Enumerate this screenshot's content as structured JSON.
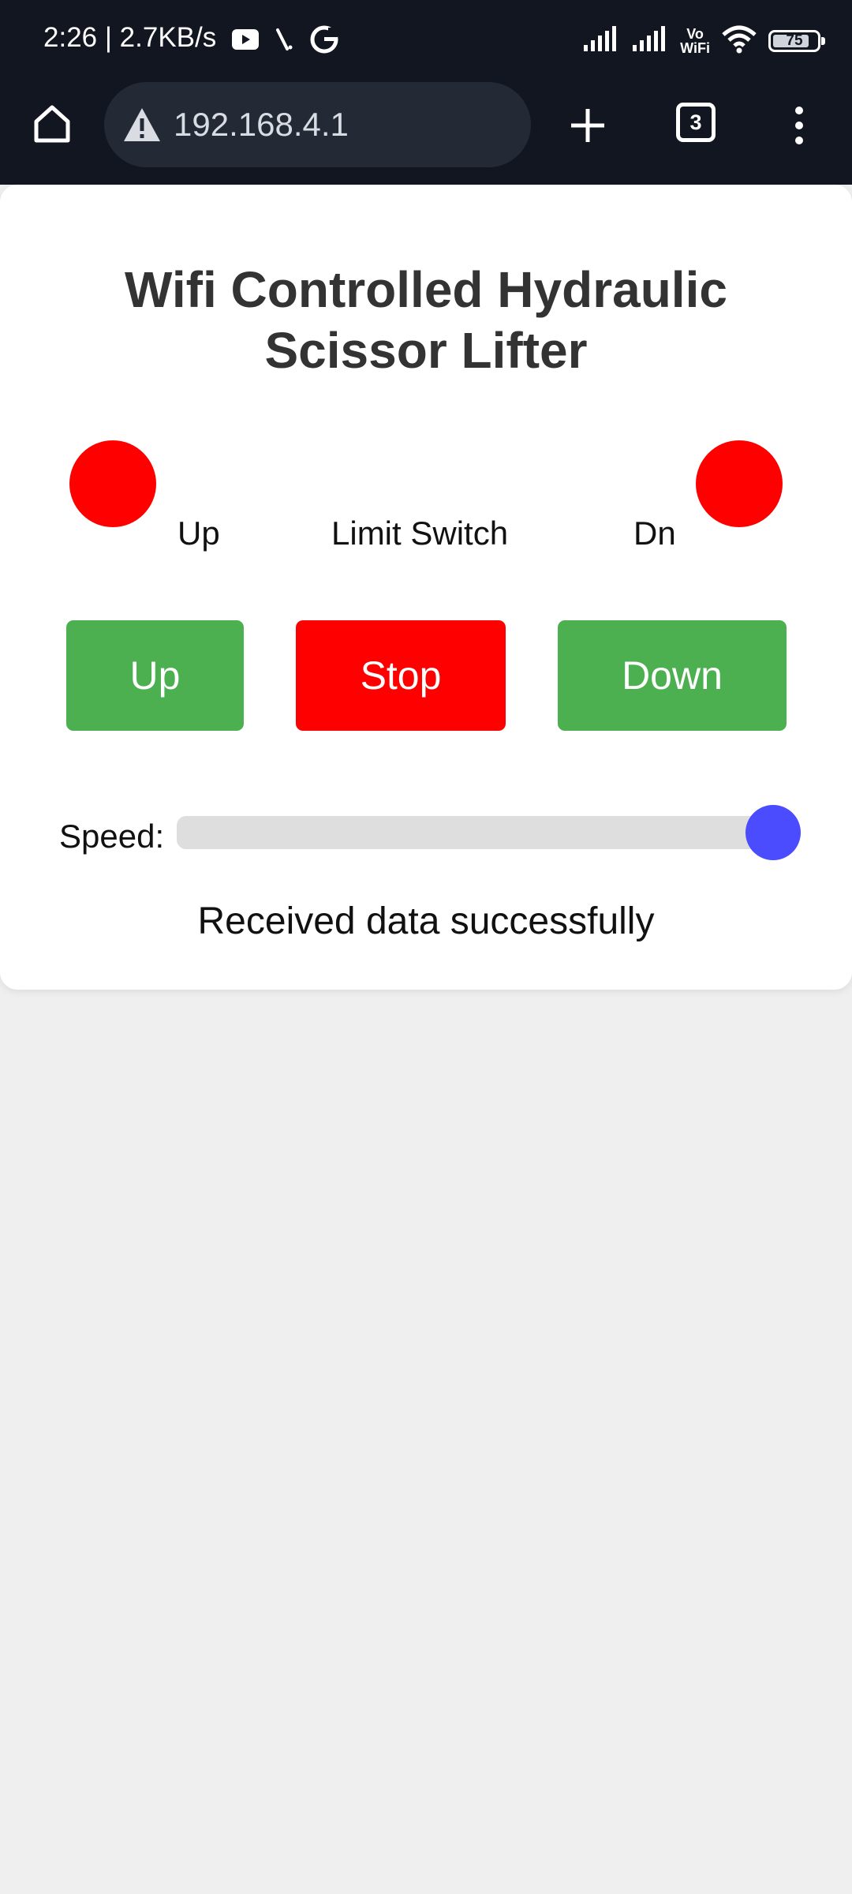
{
  "status_bar": {
    "time": "2:26 | 2.7KB/s",
    "icons": [
      "youtube-icon",
      "slash-notification-icon",
      "google-icon",
      "signal-icon",
      "signal-icon",
      "vowifi-icon",
      "wifi-icon",
      "battery-icon"
    ],
    "vowifi_top": "Vo",
    "vowifi_bottom": "WiFi",
    "battery_level": "75"
  },
  "browser": {
    "url": "192.168.4.1",
    "tab_count": "3",
    "icons": [
      "home-icon",
      "warning-icon",
      "plus-icon",
      "tabs-icon",
      "more-vertical-icon"
    ]
  },
  "page": {
    "title": "Wifi Controlled Hydraulic Scissor Lifter",
    "led_up_label": "Up",
    "limit_switch_label": "Limit Switch",
    "led_dn_label": "Dn",
    "led_color": "#ff0000",
    "buttons": {
      "up": "Up",
      "stop": "Stop",
      "down": "Down"
    },
    "button_colors": {
      "go": "#4caf50",
      "stop": "#ff0000"
    },
    "speed_label": "Speed:",
    "speed_fraction": 1.0,
    "thumb_color": "#4c4cff",
    "status_message": "Received data successfully"
  }
}
